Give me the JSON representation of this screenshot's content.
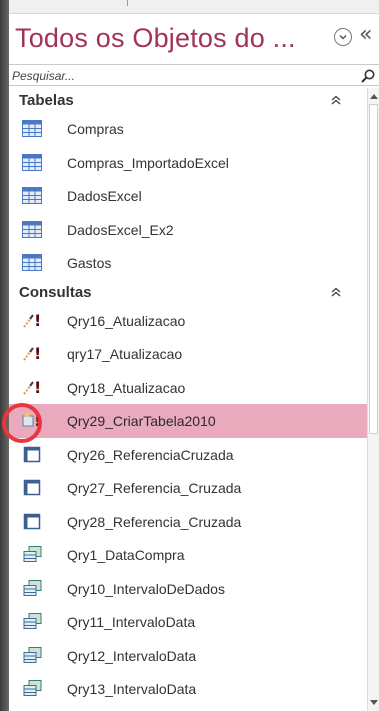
{
  "pane": {
    "title": "Todos os Objetos do ...",
    "menu_icon": "chevron-down-circle-icon",
    "collapse_glyph": "«"
  },
  "search": {
    "placeholder": "Pesquisar...",
    "value": ""
  },
  "groups": [
    {
      "label": "Tabelas",
      "items": [
        {
          "label": "Compras",
          "icon": "table-icon"
        },
        {
          "label": "Compras_ImportadoExcel",
          "icon": "table-icon"
        },
        {
          "label": "DadosExcel",
          "icon": "table-icon"
        },
        {
          "label": "DadosExcel_Ex2",
          "icon": "table-icon"
        },
        {
          "label": "Gastos",
          "icon": "table-icon"
        }
      ]
    },
    {
      "label": "Consultas",
      "items": [
        {
          "label": "Qry16_Atualizacao",
          "icon": "update-query-icon"
        },
        {
          "label": "qry17_Atualizacao",
          "icon": "update-query-icon"
        },
        {
          "label": "Qry18_Atualizacao",
          "icon": "update-query-icon"
        },
        {
          "label": "Qry29_CriarTabela2010",
          "icon": "make-table-query-icon",
          "selected": true
        },
        {
          "label": "Qry26_ReferenciaCruzada",
          "icon": "crosstab-query-icon"
        },
        {
          "label": "Qry27_Referencia_Cruzada",
          "icon": "crosstab-query-icon"
        },
        {
          "label": "Qry28_Referencia_Cruzada",
          "icon": "crosstab-query-icon"
        },
        {
          "label": "Qry1_DataCompra",
          "icon": "select-query-icon"
        },
        {
          "label": "Qry10_IntervaloDeDados",
          "icon": "select-query-icon"
        },
        {
          "label": "Qry11_IntervaloData",
          "icon": "select-query-icon"
        },
        {
          "label": "Qry12_IntervaloData",
          "icon": "select-query-icon"
        },
        {
          "label": "Qry13_IntervaloData",
          "icon": "select-query-icon"
        }
      ]
    }
  ],
  "colors": {
    "title": "#a3325a",
    "selected_row": "#e9aabe",
    "highlight_circle": "#e8363e",
    "table_icon": "#4a78c2"
  }
}
